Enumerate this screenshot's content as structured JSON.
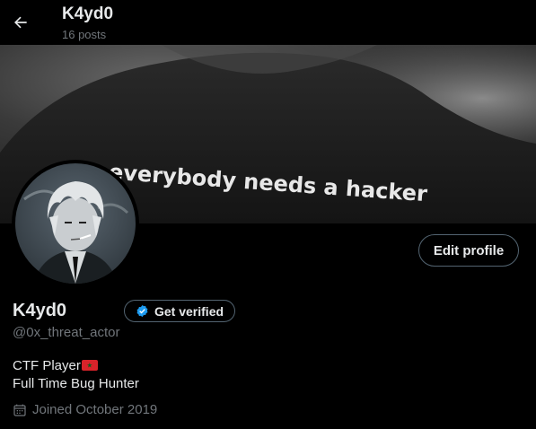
{
  "header": {
    "back_icon": "arrow-left-icon",
    "title": "K4yd0",
    "posts_count": "16 posts"
  },
  "banner": {
    "shirt_text": "everybody needs a hacker"
  },
  "profile": {
    "display_name": "K4yd0",
    "handle": "@0x_threat_actor",
    "edit_button_label": "Edit profile",
    "verify_button_label": "Get verified",
    "verify_icon": "verified-badge-icon",
    "bio_line1": "CTF Player",
    "bio_flag_icon": "morocco-flag-icon",
    "bio_line2": "Full Time Bug Hunter",
    "joined_icon": "calendar-icon",
    "joined_text": "Joined October 2019"
  },
  "colors": {
    "background": "#000000",
    "primary_text": "#e7e9ea",
    "secondary_text": "#71767b",
    "border": "#536471",
    "verified_blue": "#1d9bf0"
  }
}
